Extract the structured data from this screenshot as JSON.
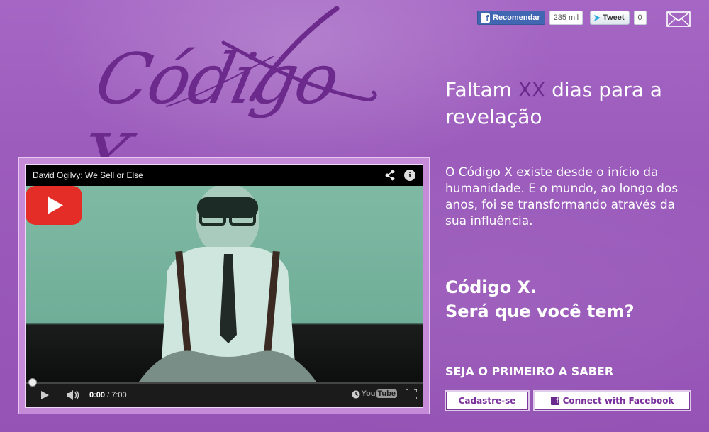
{
  "social": {
    "facebook_like_label": "Recomendar",
    "facebook_like_count": "235 mil",
    "tweet_label": "Tweet",
    "tweet_count": "0",
    "mail_icon": "envelope-icon"
  },
  "logo": {
    "text": "Código X"
  },
  "countdown": {
    "before": "Faltam ",
    "highlight": "XX",
    "after": " dias para a revelação"
  },
  "intro": "O Código X existe desde o início da humanidade. E o mundo, ao longo dos anos, foi se transformando através da sua influência.",
  "tagline": {
    "line1": "Código X.",
    "line2": "Será que você tem?"
  },
  "signup": {
    "heading": "SEJA O PRIMEIRO A SABER",
    "register_label": "Cadastre-se",
    "facebook_connect_label": "Connect with Facebook"
  },
  "video": {
    "title": "David Ogilvy: We Sell or Else",
    "current_time": "0:00",
    "duration": "/ 7:00",
    "youtube_label": "You",
    "youtube_tube": "Tube",
    "progress": 0
  },
  "colors": {
    "background": "#9c5cbc",
    "accent": "#6a2a8e",
    "youtube_red": "#e52d27",
    "facebook_blue": "#4267b2"
  }
}
